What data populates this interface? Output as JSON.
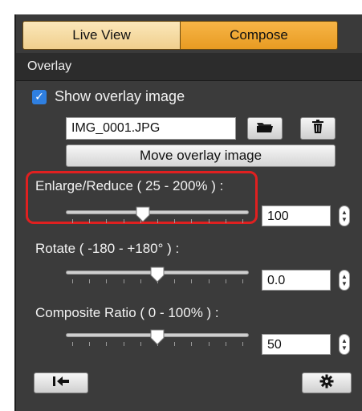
{
  "tabs": [
    {
      "label": "Live View",
      "selected": false
    },
    {
      "label": "Compose",
      "selected": true
    }
  ],
  "section": {
    "title": "Overlay"
  },
  "overlay": {
    "show_label": "Show overlay image",
    "show_checked": true,
    "filename": "IMG_0001.JPG",
    "open_icon": "folder-icon",
    "delete_icon": "trash-icon",
    "move_label": "Move overlay image"
  },
  "sliders": [
    {
      "id": "enlarge",
      "label": "Enlarge/Reduce ( 25 - 200% ) :",
      "value": "100",
      "fraction": 0.42,
      "highlighted": true
    },
    {
      "id": "rotate",
      "label": "Rotate ( -180 - +180° ) :",
      "value": "0.0",
      "fraction": 0.5,
      "highlighted": false
    },
    {
      "id": "ratio",
      "label": "Composite Ratio ( 0 - 100% ) :",
      "value": "50",
      "fraction": 0.5,
      "highlighted": false
    }
  ],
  "footer": {
    "reset_icon": "reset-arrow-icon",
    "settings_icon": "gear-icon"
  },
  "colors": {
    "accent": "#f0a93a",
    "highlight": "#e02020",
    "panel": "#3a3a3a",
    "checkbox": "#2f7fe0"
  }
}
